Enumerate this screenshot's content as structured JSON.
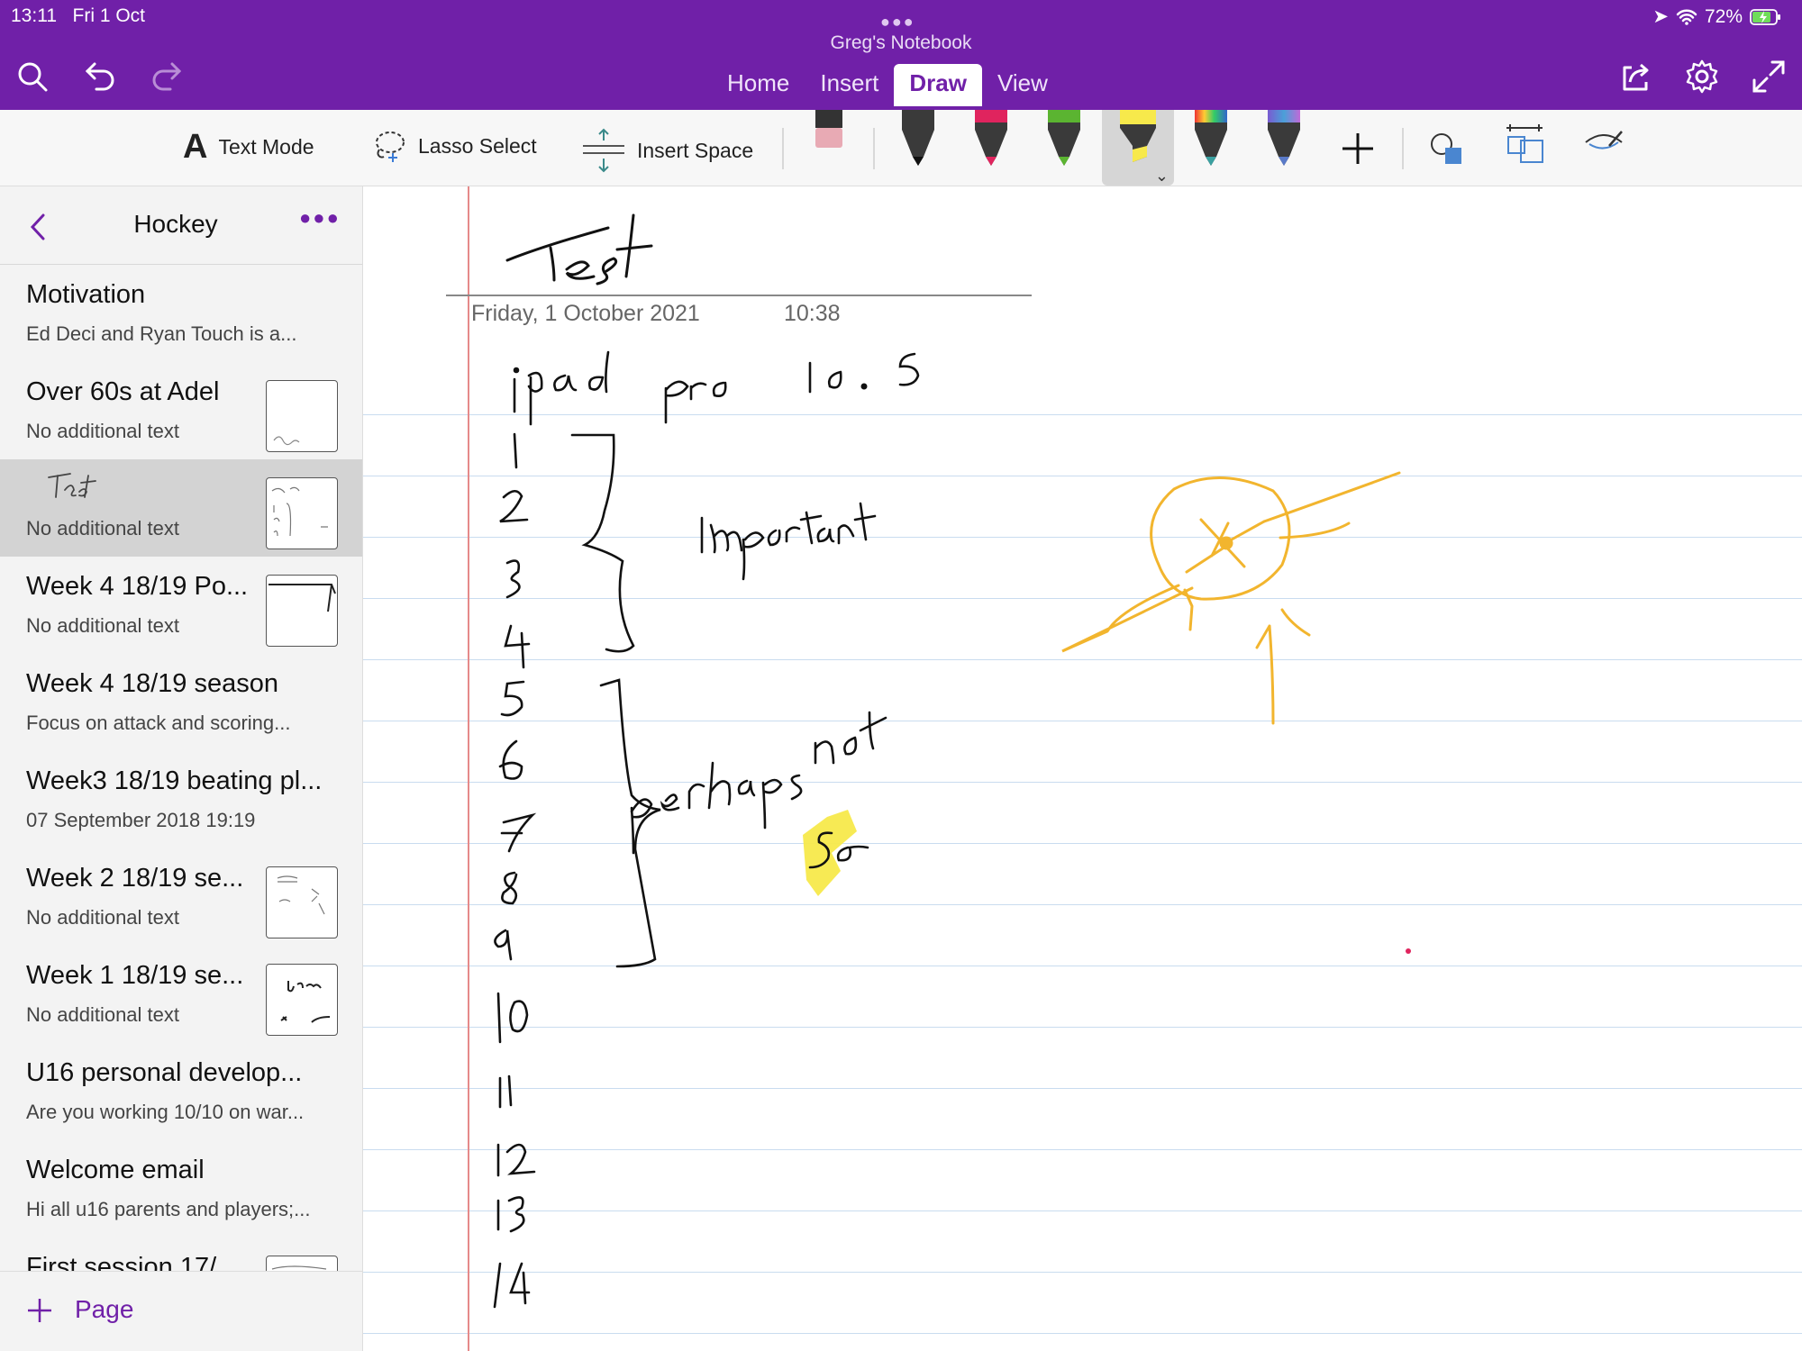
{
  "status": {
    "time": "13:11",
    "date": "Fri 1 Oct",
    "battery": "72%"
  },
  "app": {
    "notebook_title": "Greg's Notebook"
  },
  "tabs": [
    {
      "label": "Home"
    },
    {
      "label": "Insert"
    },
    {
      "label": "Draw"
    },
    {
      "label": "View"
    }
  ],
  "ribbon": {
    "text_mode_label": "Text Mode",
    "lasso_label": "Lasso Select",
    "insert_space_label": "Insert Space"
  },
  "pens": [
    {
      "name": "eraser",
      "color": "#e8aab4"
    },
    {
      "name": "black-pen",
      "color": "#222222"
    },
    {
      "name": "pink-pen",
      "color": "#e0245e"
    },
    {
      "name": "green-pen",
      "color": "#5bb431"
    },
    {
      "name": "yellow-highlighter",
      "color": "#f7e94b"
    },
    {
      "name": "rainbow-pen",
      "color": "#8a6bd1"
    },
    {
      "name": "galaxy-pen",
      "color": "#5a7ac8"
    }
  ],
  "sidebar": {
    "section_title": "Hockey",
    "add_page_label": "Page",
    "pages": [
      {
        "title": "Motivation",
        "subtitle": "Ed Deci and Ryan  Touch is a..."
      },
      {
        "title": "Over 60s at Adel",
        "subtitle": "No additional text"
      },
      {
        "title": "",
        "subtitle": "No additional text"
      },
      {
        "title": "Week 4 18/19 Po...",
        "subtitle": "No additional text"
      },
      {
        "title": "Week 4 18/19 season",
        "subtitle": "Focus on attack and scoring..."
      },
      {
        "title": "Week3 18/19 beating pl...",
        "subtitle": "07 September 2018  19:19"
      },
      {
        "title": "Week 2 18/19 se...",
        "subtitle": "No additional text"
      },
      {
        "title": "Week 1 18/19 se...",
        "subtitle": "No additional text"
      },
      {
        "title": "U16 personal develop...",
        "subtitle": "Are you working 10/10 on war..."
      },
      {
        "title": "Welcome email",
        "subtitle": "Hi all u16 parents and players;..."
      },
      {
        "title": "First session 17/",
        "subtitle": ""
      }
    ]
  },
  "page": {
    "date": "Friday, 1 October 2021",
    "time": "10:38"
  },
  "ink_text": {
    "title": "Test",
    "heading": "ipad pro 10.5",
    "numbers": [
      "1",
      "2",
      "3",
      "4",
      "5",
      "6",
      "7",
      "8",
      "9",
      "10",
      "11",
      "12",
      "13",
      "14"
    ],
    "label_a": "Important",
    "label_b": "perhaps not",
    "highlighted": "So"
  }
}
